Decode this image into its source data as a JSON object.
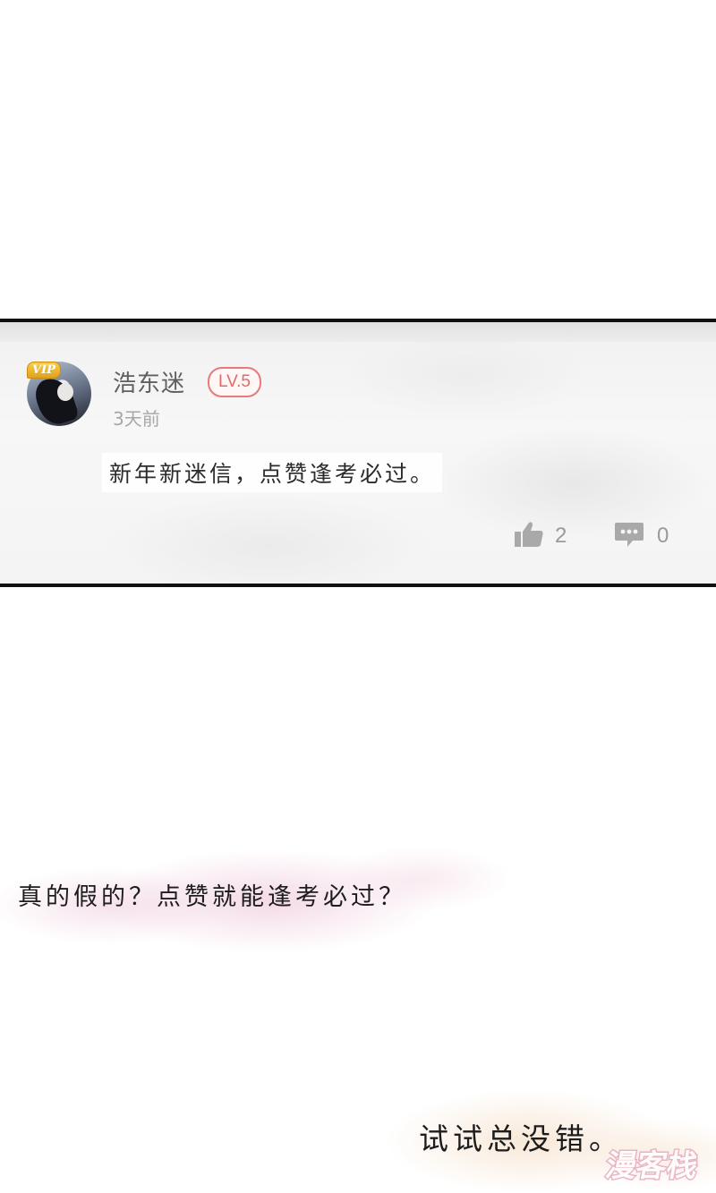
{
  "comment": {
    "username": "浩东迷",
    "level": "LV.5",
    "vip": "VIP",
    "time_ago": "3天前",
    "text": "新年新迷信，点赞逢考必过。",
    "likes": "2",
    "replies": "0"
  },
  "dialogue": {
    "line1": "真的假的？点赞就能逢考必过？",
    "line2": "试试总没错。"
  },
  "watermark": {
    "text": "漫客栈"
  },
  "colors": {
    "level_badge": "#e16a6a",
    "border": "#111111",
    "vip_gold": "#e0a21b"
  },
  "icons": {
    "like": "thumbs-up-icon",
    "reply": "comment-bubble-icon"
  }
}
